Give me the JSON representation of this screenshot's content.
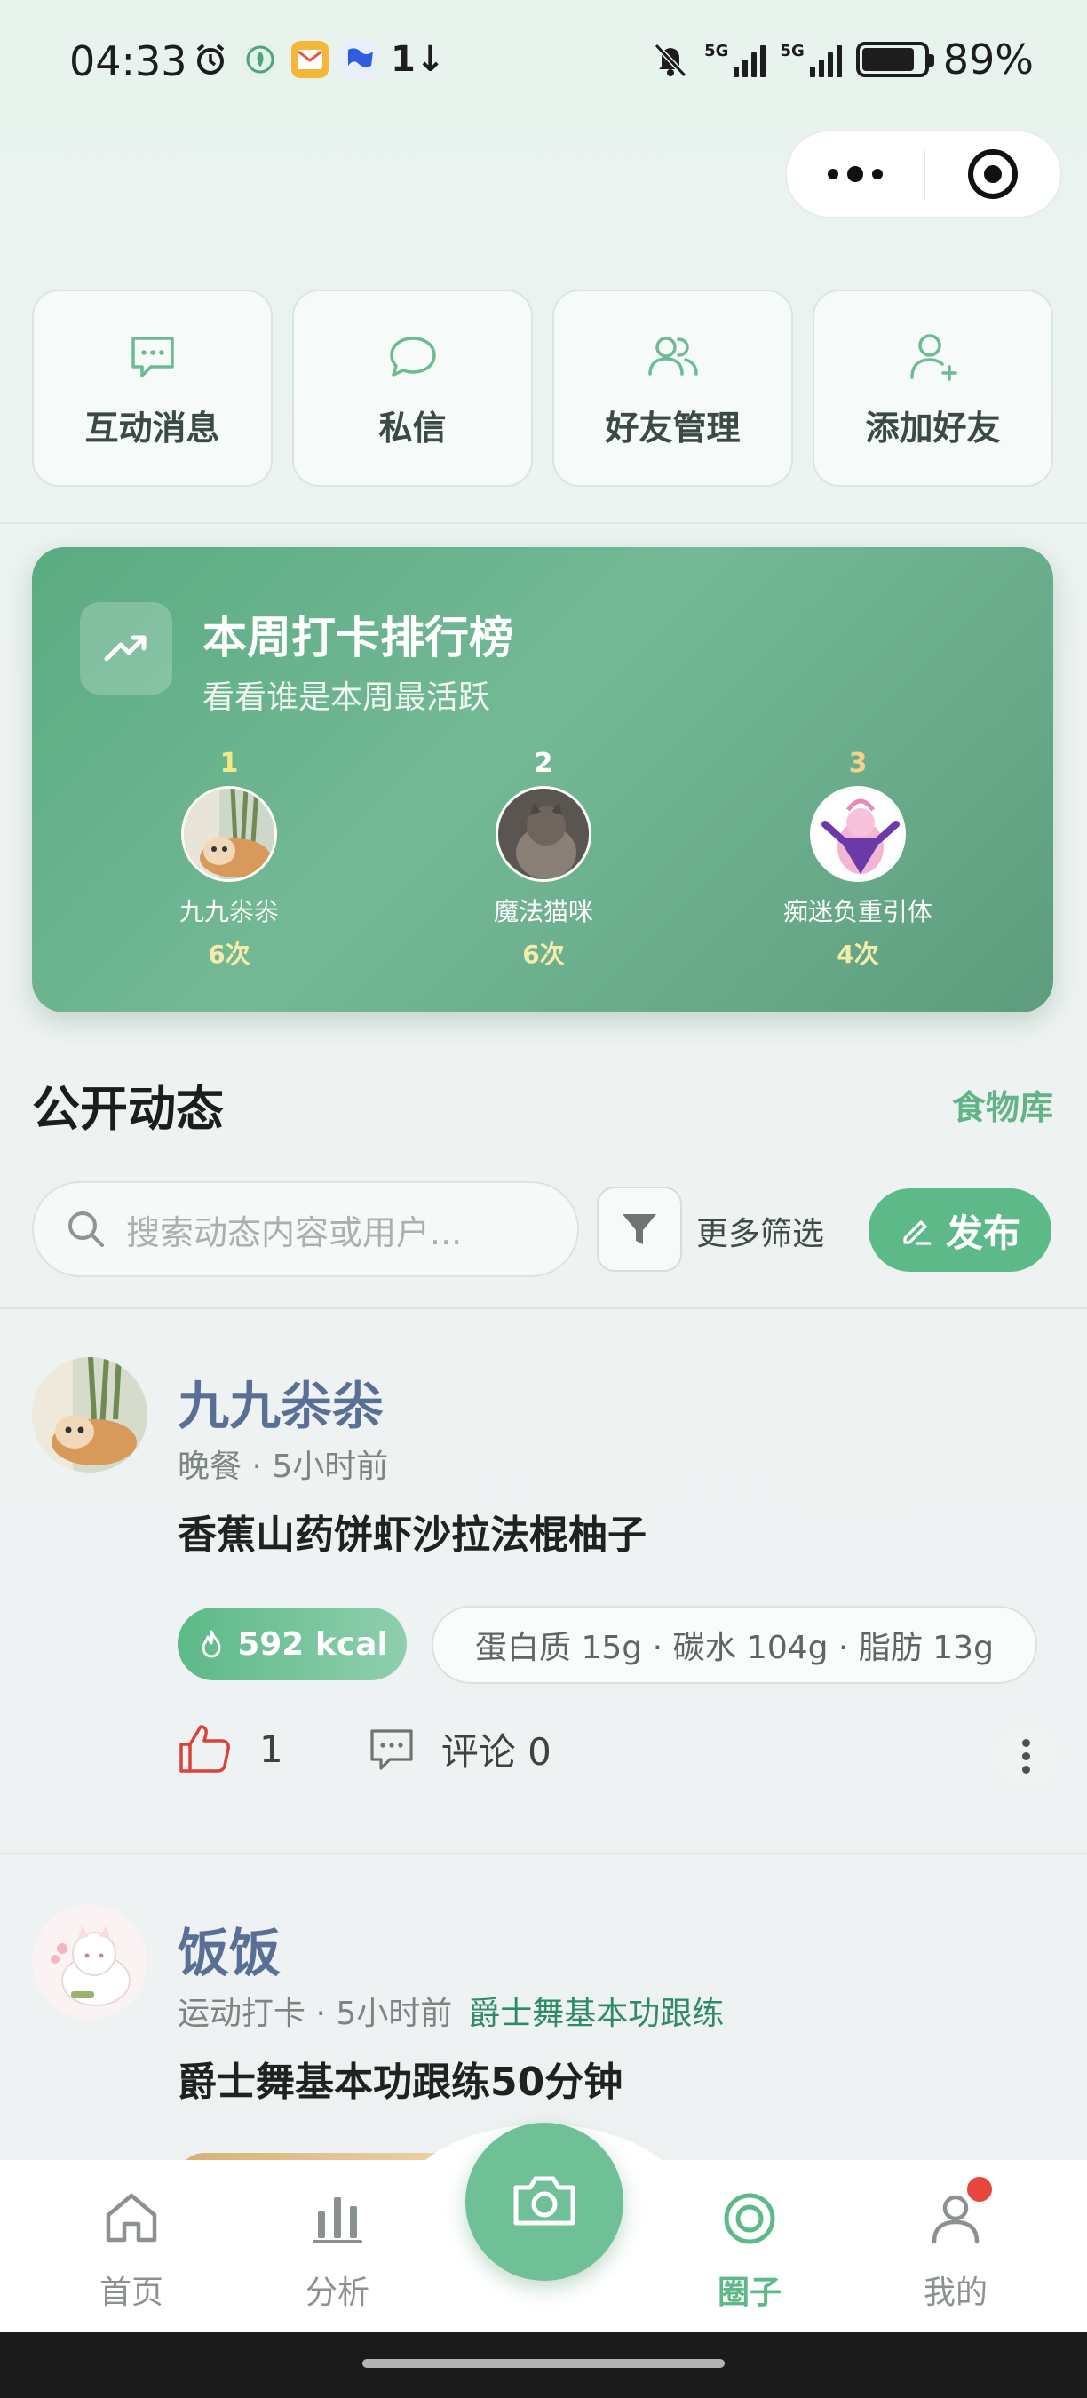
{
  "status_bar": {
    "time": "04:33",
    "network_1": "5G",
    "network_2": "5G",
    "battery": "89%",
    "data_arrows": "1↓"
  },
  "quick_actions": [
    {
      "label": "互动消息",
      "icon": "message-dots-icon"
    },
    {
      "label": "私信",
      "icon": "chat-bubble-icon"
    },
    {
      "label": "好友管理",
      "icon": "users-icon"
    },
    {
      "label": "添加好友",
      "icon": "user-plus-icon"
    }
  ],
  "leaderboard": {
    "title": "本周打卡排行榜",
    "subtitle": "看看谁是本周最活跃",
    "ranks": [
      {
        "rank": "1",
        "name": "九九尜尜",
        "count": "6次"
      },
      {
        "rank": "2",
        "name": "魔法猫咪",
        "count": "6次"
      },
      {
        "rank": "3",
        "name": "痴迷负重引体",
        "count": "4次"
      }
    ]
  },
  "feed": {
    "title": "公开动态",
    "food_link": "食物库",
    "search_placeholder": "搜索动态内容或用户...",
    "more_filter": "更多筛选",
    "publish_label": "发布"
  },
  "posts": [
    {
      "user": "九九尜尜",
      "meta": "晚餐 · 5小时前",
      "content": "香蕉山药饼虾沙拉法棍柚子",
      "kcal": "592 kcal",
      "macros": "蛋白质 15g · 碳水 104g · 脂肪 13g",
      "likes": "1",
      "comments": "评论 0"
    },
    {
      "user": "饭饭",
      "meta": "运动打卡 · 5小时前",
      "tag": "爵士舞基本功跟练",
      "content": "爵士舞基本功跟练50分钟"
    }
  ],
  "tabbar": {
    "tabs": [
      {
        "label": "首页",
        "icon": "home-icon"
      },
      {
        "label": "分析",
        "icon": "bar-chart-icon"
      },
      {
        "label": "圈子",
        "icon": "circle-target-icon"
      },
      {
        "label": "我的",
        "icon": "profile-icon"
      }
    ],
    "center_icon": "camera-icon"
  },
  "colors": {
    "accent": "#5db987",
    "board_gradient_start": "#5aab82",
    "username": "#5a6f95",
    "like_red": "#d9423a",
    "badge_red": "#e8453c"
  }
}
